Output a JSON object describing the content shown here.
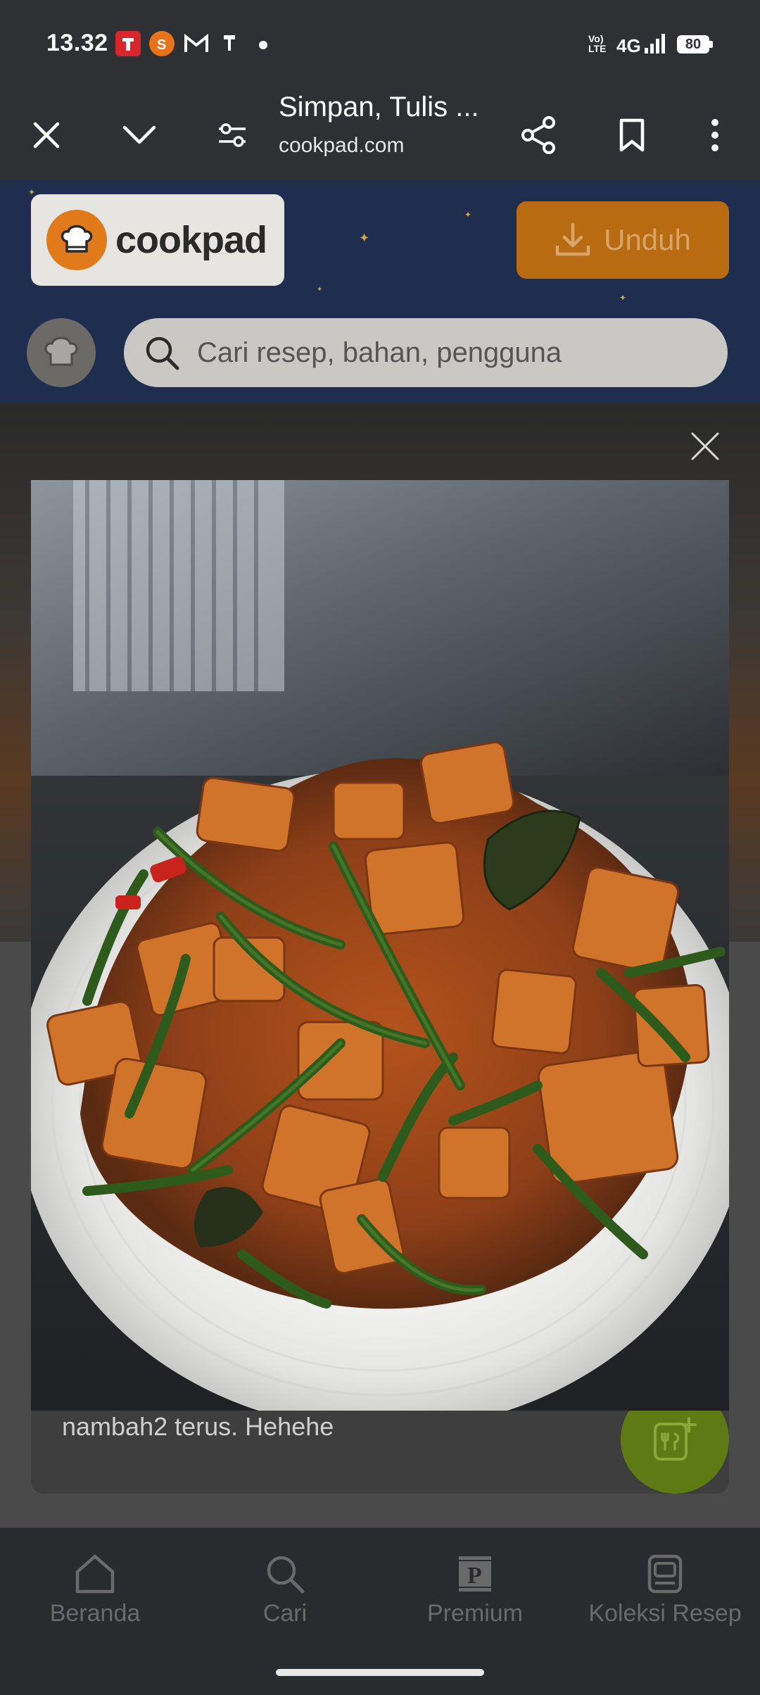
{
  "status_bar": {
    "time": "13.32",
    "network": "4G",
    "volte": "Vo) LTE",
    "battery": "80"
  },
  "browser_bar": {
    "title": "Simpan, Tulis ...",
    "url": "cookpad.com"
  },
  "site_header": {
    "logo_text": "cookpad",
    "download_label": "Unduh",
    "search_placeholder": "Cari resep, bahan, pengguna"
  },
  "page": {
    "snippet_text": "nambah2 terus. Hehehe"
  },
  "bottom_nav": {
    "items": [
      {
        "label": "Beranda",
        "icon": "home-icon"
      },
      {
        "label": "Cari",
        "icon": "search-icon"
      },
      {
        "label": "Premium",
        "icon": "premium-icon"
      },
      {
        "label": "Koleksi Resep",
        "icon": "collection-icon"
      }
    ]
  },
  "colors": {
    "brand_orange": "#e07a1a",
    "header_navy": "#1f2d4e",
    "fab_green": "#5e7a14"
  }
}
